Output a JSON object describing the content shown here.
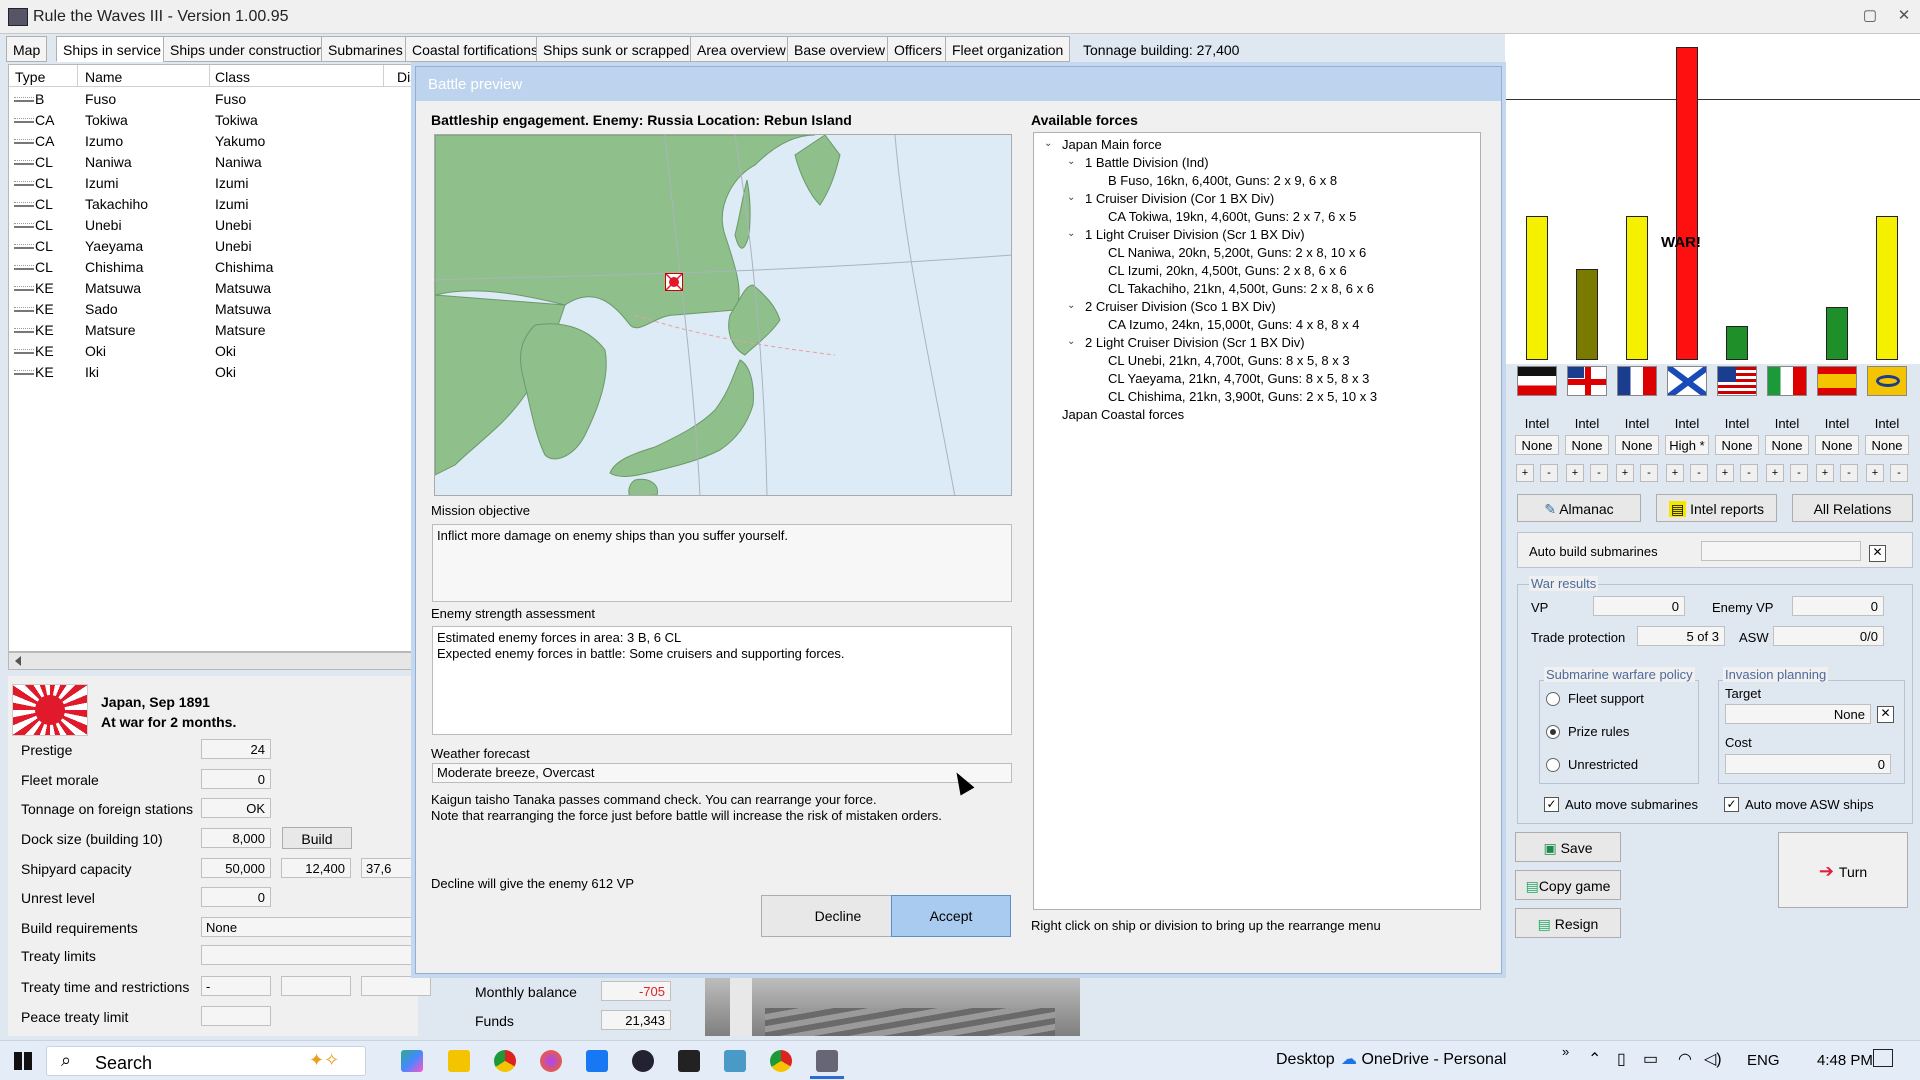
{
  "window": {
    "title": "Rule the Waves III - Version 1.00.95"
  },
  "tabs": [
    "Map",
    "Ships in service",
    "Ships under construction",
    "Submarines",
    "Coastal fortifications",
    "Ships sunk or scrapped",
    "Area overview",
    "Base overview",
    "Officers",
    "Fleet organization"
  ],
  "tonnage_building": "Tonnage building: 27,400",
  "ship_list": {
    "headers": [
      "Type",
      "Name",
      "Class",
      "Dis"
    ],
    "rows": [
      {
        "type": "B",
        "name": "Fuso",
        "class": "Fuso"
      },
      {
        "type": "CA",
        "name": "Tokiwa",
        "class": "Tokiwa"
      },
      {
        "type": "CA",
        "name": "Izumo",
        "class": "Yakumo"
      },
      {
        "type": "CL",
        "name": "Naniwa",
        "class": "Naniwa"
      },
      {
        "type": "CL",
        "name": "Izumi",
        "class": "Izumi"
      },
      {
        "type": "CL",
        "name": "Takachiho",
        "class": "Izumi"
      },
      {
        "type": "CL",
        "name": "Unebi",
        "class": "Unebi"
      },
      {
        "type": "CL",
        "name": "Yaeyama",
        "class": "Unebi"
      },
      {
        "type": "CL",
        "name": "Chishima",
        "class": "Chishima"
      },
      {
        "type": "KE",
        "name": "Matsuwa",
        "class": "Matsuwa"
      },
      {
        "type": "KE",
        "name": "Sado",
        "class": "Matsuwa"
      },
      {
        "type": "KE",
        "name": "Matsure",
        "class": "Matsure"
      },
      {
        "type": "KE",
        "name": "Oki",
        "class": "Oki"
      },
      {
        "type": "KE",
        "name": "Iki",
        "class": "Oki"
      }
    ]
  },
  "nation": {
    "heading": "Japan, Sep 1891",
    "subheading": "At war for 2 months.",
    "prestige_label": "Prestige",
    "prestige": "24",
    "morale_label": "Fleet morale",
    "morale": "0",
    "foreign_label": "Tonnage on foreign stations",
    "foreign": "OK",
    "dock_label": "Dock size (building 10)",
    "dock": "8,000",
    "build_btn": "Build",
    "shipyard_label": "Shipyard capacity",
    "shipyard1": "50,000",
    "shipyard2": "12,400",
    "shipyard3": "37,6",
    "unrest_label": "Unrest level",
    "unrest": "0",
    "buildreq_label": "Build requirements",
    "buildreq": "None",
    "treaty_label": "Treaty limits",
    "treatytime_label": "Treaty time and restrictions",
    "treatytime": "-",
    "peace_label": "Peace treaty limit",
    "monthly_label": "Monthly balance",
    "monthly": "-705",
    "funds_label": "Funds",
    "funds": "21,343"
  },
  "dialog": {
    "title": "Battle preview",
    "header": "Battleship engagement. Enemy: Russia Location: Rebun Island",
    "mission_label": "Mission objective",
    "mission": "Inflict more damage on enemy ships than you suffer yourself.",
    "enemy_label": "Enemy strength assessment",
    "enemy_line1": "Estimated enemy forces in area:  3 B,  6 CL",
    "enemy_line2": "Expected enemy forces in battle: Some cruisers and supporting forces.",
    "weather_label": "Weather forecast",
    "weather": "Moderate breeze, Overcast",
    "command_line1": "Kaigun taisho Tanaka passes command check. You can rearrange your force.",
    "command_line2": "Note that rearranging the force just before battle will increase the risk of mistaken orders.",
    "decline_note": "Decline will give the enemy 612 VP",
    "decline": "Decline",
    "accept": "Accept",
    "forces_label": "Available forces",
    "tree": [
      {
        "level": 0,
        "text": "Japan Main force",
        "exp": true
      },
      {
        "level": 1,
        "text": "1 Battle Division (Ind)",
        "exp": true
      },
      {
        "level": 2,
        "text": "B Fuso, 16kn, 6,400t, Guns: 2 x 9, 6 x 8"
      },
      {
        "level": 1,
        "text": "1 Cruiser Division (Cor 1 BX Div)",
        "exp": true
      },
      {
        "level": 2,
        "text": "CA Tokiwa, 19kn, 4,600t, Guns: 2 x 7, 6 x 5"
      },
      {
        "level": 1,
        "text": "1 Light Cruiser Division (Scr 1 BX Div)",
        "exp": true
      },
      {
        "level": 2,
        "text": "CL Naniwa, 20kn, 5,200t, Guns: 2 x 8, 10 x 6"
      },
      {
        "level": 2,
        "text": "CL Izumi, 20kn, 4,500t, Guns: 2 x 8, 6 x 6"
      },
      {
        "level": 2,
        "text": "CL Takachiho, 21kn, 4,500t, Guns: 2 x 8, 6 x 6"
      },
      {
        "level": 1,
        "text": "2 Cruiser Division (Sco 1 BX Div)",
        "exp": true
      },
      {
        "level": 2,
        "text": "CA Izumo, 24kn, 15,000t, Guns: 4 x 8, 8 x 4"
      },
      {
        "level": 1,
        "text": "2 Light Cruiser Division (Scr 1 BX Div)",
        "exp": true
      },
      {
        "level": 2,
        "text": "CL Unebi, 21kn, 4,700t, Guns: 8 x 5, 8 x 3"
      },
      {
        "level": 2,
        "text": "CL Yaeyama, 21kn, 4,700t, Guns: 8 x 5, 8 x 3"
      },
      {
        "level": 2,
        "text": "CL Chishima, 21kn, 3,900t, Guns: 2 x 5, 10 x 3"
      },
      {
        "level": 0,
        "text": "Japan Coastal forces"
      }
    ],
    "hint": "Right click on ship or division to bring up the rearrange menu"
  },
  "relations": {
    "war_label": "WAR!",
    "bars": [
      {
        "value": 0.46,
        "color": "#f5f000"
      },
      {
        "value": 0.29,
        "color": "#7a7a00"
      },
      {
        "value": 0.46,
        "color": "#f5f000"
      },
      {
        "value": 1.0,
        "color": "#ff1010"
      },
      {
        "value": 0.11,
        "color": "#1f8f2a"
      },
      {
        "value": 0.0,
        "color": "#f5f000"
      },
      {
        "value": 0.17,
        "color": "#1f8f2a"
      },
      {
        "value": 0.46,
        "color": "#f5f000"
      }
    ],
    "flags": [
      "germany-flag-icon",
      "britain-flag-icon",
      "france-flag-icon",
      "russia-flag-icon",
      "usa-flag-icon",
      "italy-flag-icon",
      "spain-flag-icon",
      "china-flag-icon"
    ],
    "intel_label": "Intel",
    "intel_levels": [
      "None",
      "None",
      "None",
      "High *",
      "None",
      "None",
      "None",
      "None"
    ]
  },
  "side": {
    "almanac": "Almanac",
    "intel_reports": "Intel reports",
    "all_relations": "All Relations",
    "auto_build": "Auto build submarines",
    "war_results": "War results",
    "vp_label": "VP",
    "vp": "0",
    "enemy_vp_label": "Enemy VP",
    "enemy_vp": "0",
    "trade_label": "Trade protection",
    "trade": "5 of 3",
    "asw_label": "ASW",
    "asw": "0/0",
    "sub_policy": "Submarine warfare policy",
    "opt_fleet": "Fleet support",
    "opt_prize": "Prize rules",
    "opt_unres": "Unrestricted",
    "invasion": "Invasion planning",
    "target_label": "Target",
    "target": "None",
    "cost_label": "Cost",
    "cost": "0",
    "auto_subs": "Auto move submarines",
    "auto_asw": "Auto move ASW ships",
    "save": "Save",
    "copy": "Copy game",
    "resign": "Resign",
    "turn": "Turn"
  },
  "taskbar": {
    "search": "Search",
    "desktop": "Desktop",
    "onedrive": "OneDrive - Personal",
    "lang": "ENG",
    "time": "4:48 PM"
  }
}
